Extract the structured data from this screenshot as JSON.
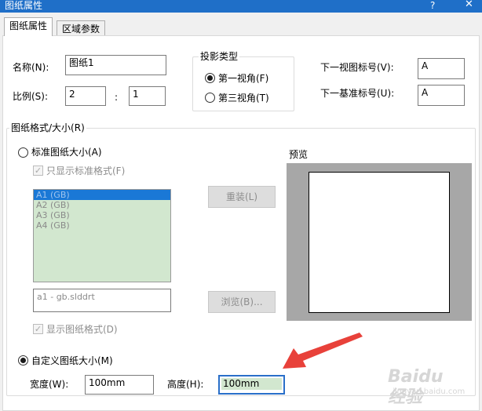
{
  "window": {
    "title": "图纸属性",
    "help": "?",
    "close": "✕"
  },
  "tabs": [
    {
      "label": "图纸属性",
      "active": true
    },
    {
      "label": "区域参数",
      "active": false
    }
  ],
  "sheet": {
    "name_label": "名称(N):",
    "name_value": "图纸1",
    "scale_label": "比例(S):",
    "scale_a": "2",
    "scale_sep": ":",
    "scale_b": "1"
  },
  "projection": {
    "title": "投影类型",
    "first_angle": "第一视角(F)",
    "third_angle": "第三视角(T)",
    "selected": "first"
  },
  "labels": {
    "next_view_label": "下一视图标号(V):",
    "next_view_value": "A",
    "next_datum_label": "下一基准标号(U):",
    "next_datum_value": "A"
  },
  "format": {
    "title": "图纸格式/大小(R)",
    "standard_label": "标准图纸大小(A)",
    "only_standard_label": "只显示标准格式(F)",
    "only_standard_checked": true,
    "sizes": [
      "A1 (GB)",
      "A2 (GB)",
      "A3 (GB)",
      "A4 (GB)"
    ],
    "selected_size": "A1 (GB)",
    "reload_button": "重装(L)",
    "file_value": "a1 - gb.slddrt",
    "browse_button": "浏览(B)...",
    "show_format_label": "显示图纸格式(D)",
    "show_format_checked": true,
    "preview_label": "预览",
    "custom_label": "自定义图纸大小(M)",
    "custom_selected": true,
    "width_label": "宽度(W):",
    "width_value": "100mm",
    "height_label": "高度(H):",
    "height_value": "100mm"
  },
  "watermark": {
    "text": "Baidu 经验",
    "sub": "jingyan.baidu.com"
  },
  "colors": {
    "titlebar": "#1f6fc8",
    "list_bg": "#d2e7cf",
    "list_selected": "#1a78d6",
    "arrow": "#e8413a"
  }
}
